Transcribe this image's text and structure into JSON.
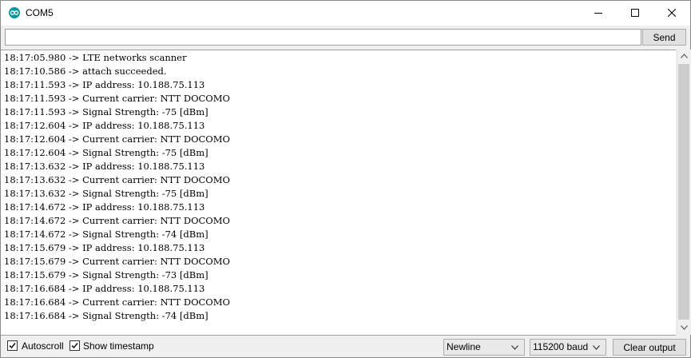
{
  "window": {
    "title": "COM5",
    "icon": "arduino-icon",
    "controls": [
      "minimize-icon",
      "maximize-icon",
      "close-icon"
    ]
  },
  "send": {
    "input_value": "",
    "button_label": "Send"
  },
  "output": {
    "lines": [
      "18:17:05.980 -> LTE networks scanner",
      "18:17:10.586 -> attach succeeded.",
      "18:17:11.593 -> IP address: 10.188.75.113",
      "18:17:11.593 -> Current carrier: NTT DOCOMO",
      "18:17:11.593 -> Signal Strength: -75 [dBm]",
      "18:17:12.604 -> IP address: 10.188.75.113",
      "18:17:12.604 -> Current carrier: NTT DOCOMO",
      "18:17:12.604 -> Signal Strength: -75 [dBm]",
      "18:17:13.632 -> IP address: 10.188.75.113",
      "18:17:13.632 -> Current carrier: NTT DOCOMO",
      "18:17:13.632 -> Signal Strength: -75 [dBm]",
      "18:17:14.672 -> IP address: 10.188.75.113",
      "18:17:14.672 -> Current carrier: NTT DOCOMO",
      "18:17:14.672 -> Signal Strength: -74 [dBm]",
      "18:17:15.679 -> IP address: 10.188.75.113",
      "18:17:15.679 -> Current carrier: NTT DOCOMO",
      "18:17:15.679 -> Signal Strength: -73 [dBm]",
      "18:17:16.684 -> IP address: 10.188.75.113",
      "18:17:16.684 -> Current carrier: NTT DOCOMO",
      "18:17:16.684 -> Signal Strength: -74 [dBm]"
    ]
  },
  "footer": {
    "autoscroll": {
      "label": "Autoscroll",
      "checked": true
    },
    "show_timestamp": {
      "label": "Show timestamp",
      "checked": true
    },
    "line_ending": {
      "selected": "Newline"
    },
    "baud_rate": {
      "selected": "115200 baud"
    },
    "clear_button_label": "Clear output"
  },
  "colors": {
    "accent": "#00979c",
    "chrome": "#f0f0f0",
    "button_face": "#e1e1e1",
    "scroll_thumb": "#cdcdcd"
  }
}
